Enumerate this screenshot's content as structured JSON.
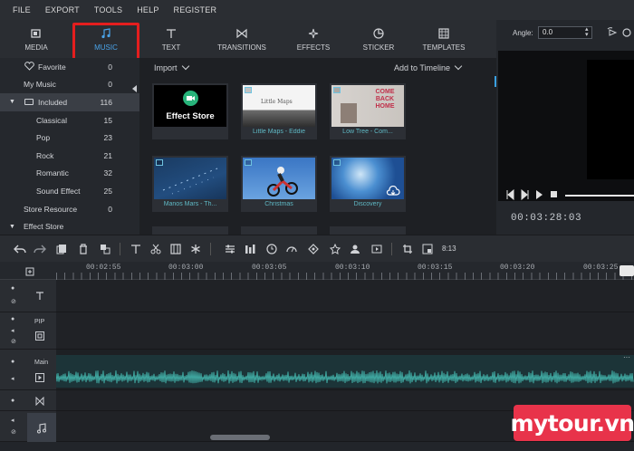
{
  "menu": [
    "FILE",
    "EXPORT",
    "TOOLS",
    "HELP",
    "REGISTER"
  ],
  "toolbar": {
    "media": "MEDIA",
    "music": "MUSIC",
    "text": "TEXT",
    "transitions": "TRANSITIONS",
    "effects": "EFFECTS",
    "sticker": "STICKER",
    "templates": "TEMPLATES",
    "active_color": "#4aa3e8"
  },
  "sidebar": {
    "items": [
      {
        "label": "Favorite",
        "count": "0"
      },
      {
        "label": "My Music",
        "count": "0"
      },
      {
        "label": "Included",
        "count": "116"
      },
      {
        "label": "Classical",
        "count": "15"
      },
      {
        "label": "Pop",
        "count": "23"
      },
      {
        "label": "Rock",
        "count": "21"
      },
      {
        "label": "Romantic",
        "count": "32"
      },
      {
        "label": "Sound Effect",
        "count": "25"
      },
      {
        "label": "Store Resource",
        "count": "0"
      },
      {
        "label": "Effect Store",
        "count": ""
      }
    ]
  },
  "media": {
    "import_label": "Import",
    "add_label": "Add to Timeline",
    "tiles": [
      {
        "caption": "",
        "thumb_text": "Effect Store"
      },
      {
        "caption": "Little Maps - Eddie",
        "thumb_text": "Little Maps"
      },
      {
        "caption": "Low Tree - Com...",
        "thumb_text": "COME BACK HOME"
      },
      {
        "caption": "Manos Mars - Th...",
        "thumb_text": ""
      },
      {
        "caption": "Christmas",
        "thumb_text": ""
      },
      {
        "caption": "Discovery",
        "thumb_text": ""
      }
    ]
  },
  "preview": {
    "angle_label": "Angle:",
    "angle_value": "0.0",
    "timecode": "00:03:28:03"
  },
  "edit_bar": {
    "ratio_label": "8:13"
  },
  "ruler": [
    "00:02:55",
    "00:03:00",
    "00:03:05",
    "00:03:10",
    "00:03:15",
    "00:03:20",
    "00:03:25"
  ],
  "tracks": {
    "pip": "PIP",
    "main": "Main"
  },
  "watermark": "mytour.vn",
  "annotation_color": "#e41e1e"
}
